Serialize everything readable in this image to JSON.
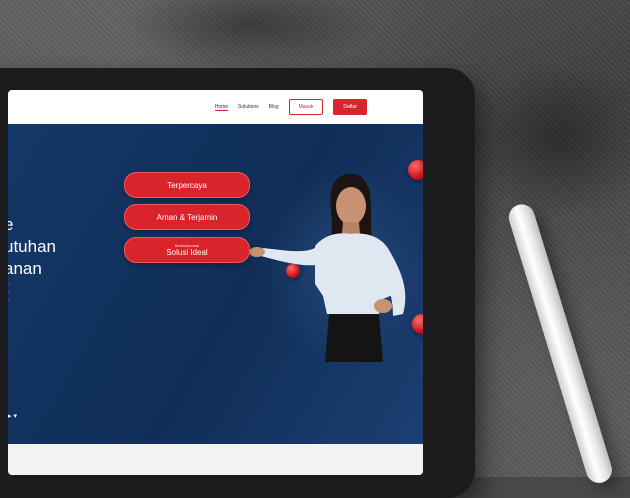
{
  "navbar": {
    "links": [
      "Home",
      "Solutions",
      "Blog"
    ],
    "login_label": "Masuk",
    "signup_label": "Daftar"
  },
  "hero": {
    "title_lines": [
      "e",
      "utuhan",
      "anan"
    ],
    "desc_lines": [
      "...",
      "...",
      "..."
    ],
    "scroll_arrow": "▸ ▾"
  },
  "pills": [
    {
      "small": "",
      "big": "Terpercaya"
    },
    {
      "small": "",
      "big": "Aman & Terjamin"
    },
    {
      "small": "Berkolaborasi",
      "big": "Solusi Ideal"
    }
  ],
  "colors": {
    "accent": "#d9242b",
    "hero_bg": "#0f2d57",
    "navbar_bg": "#ffffff"
  }
}
